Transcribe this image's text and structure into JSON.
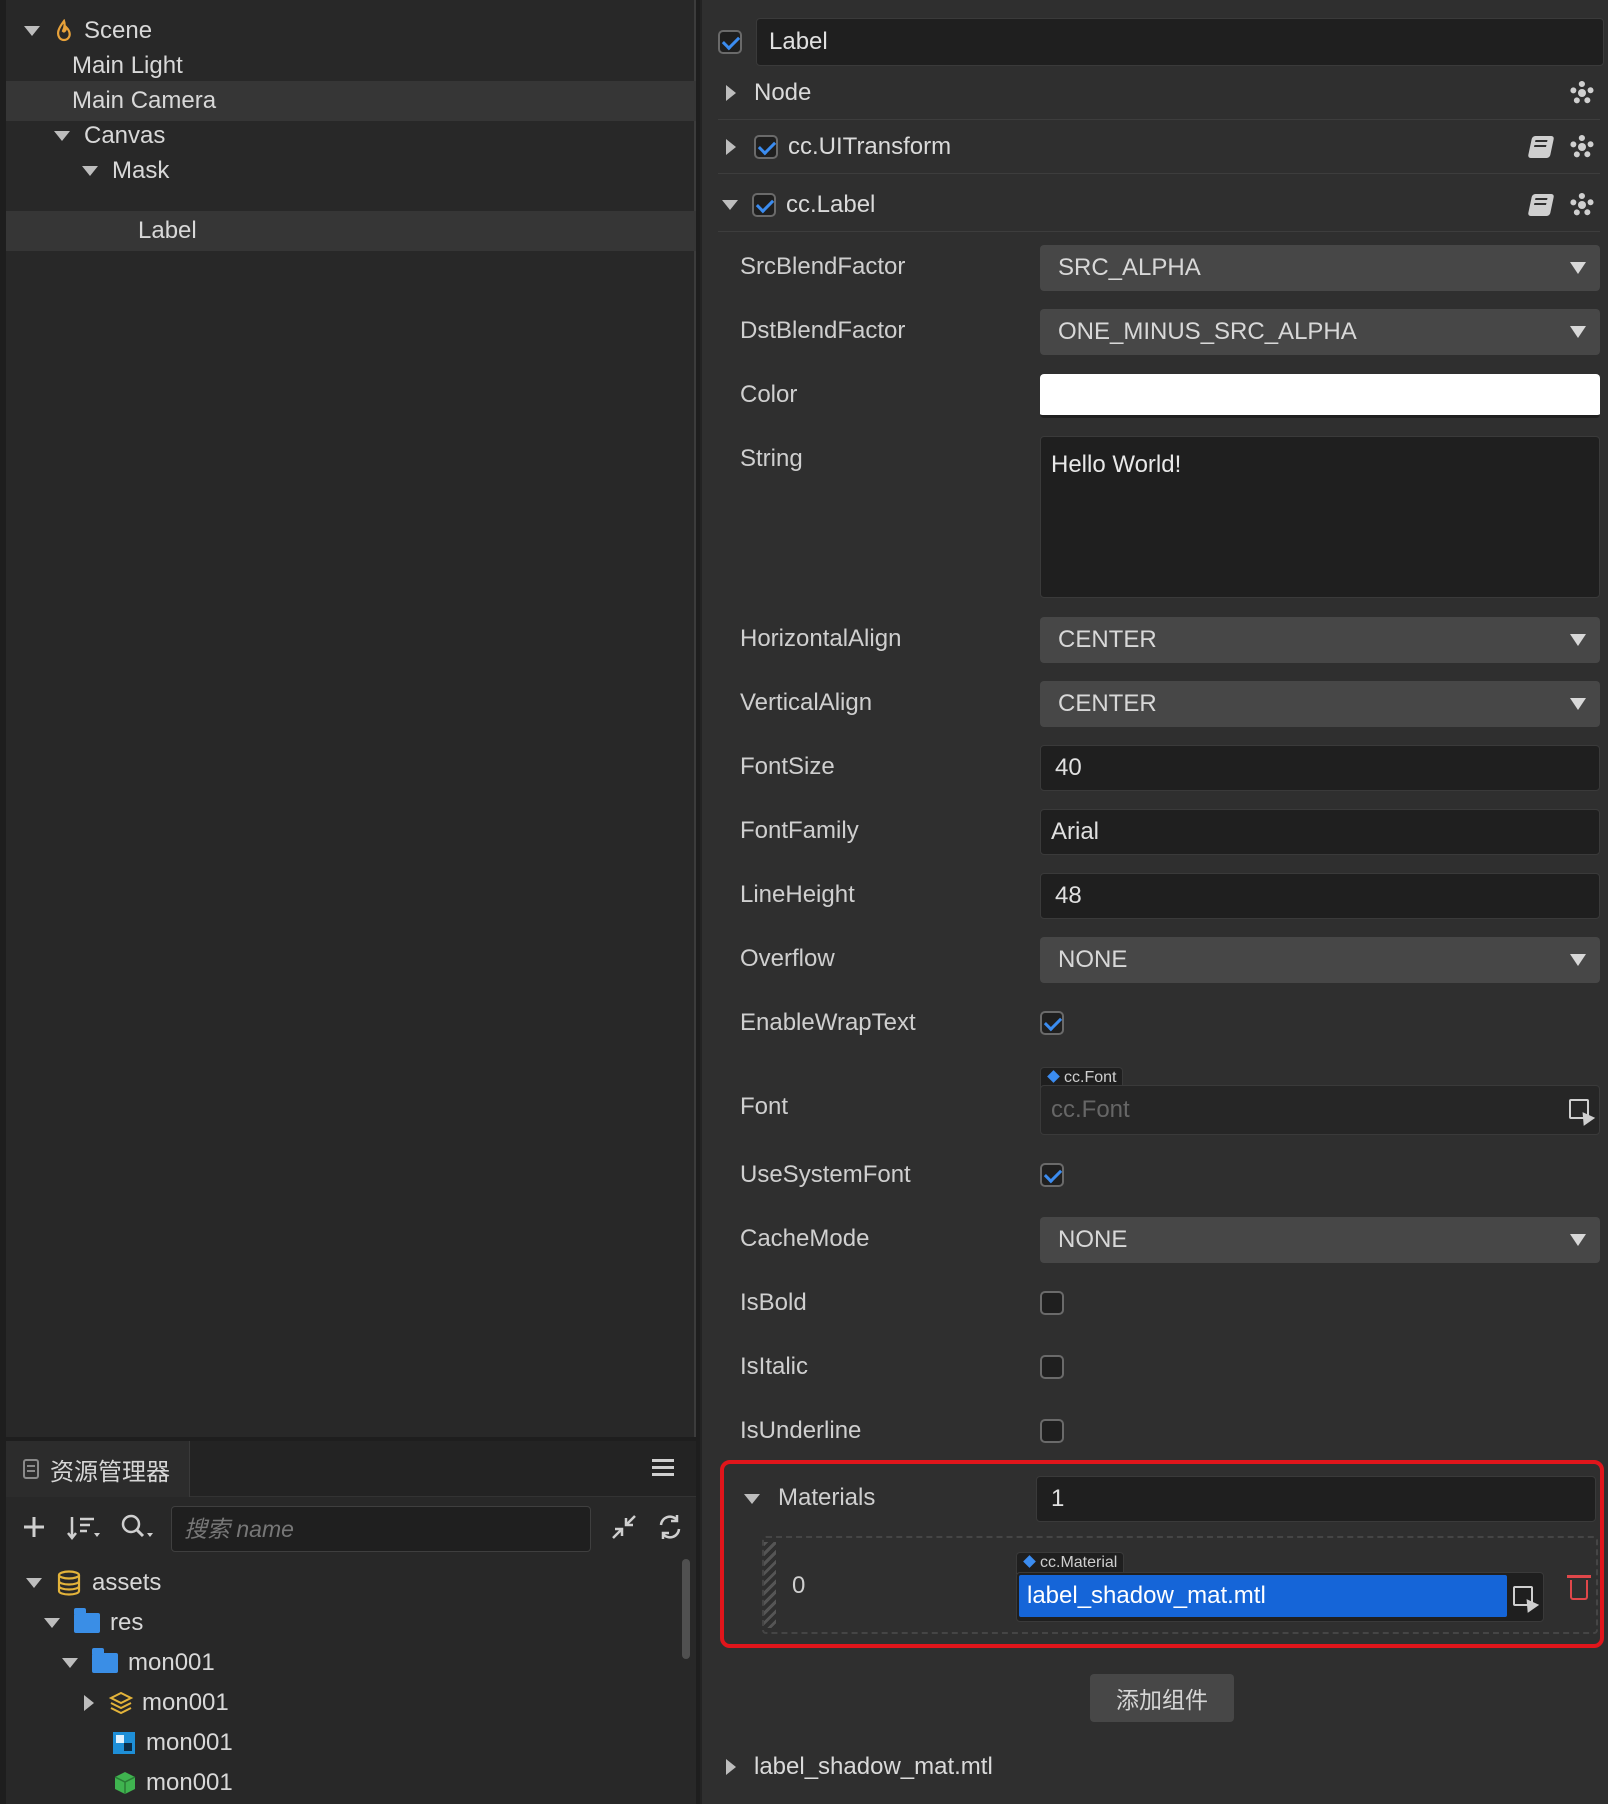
{
  "hierarchy": {
    "items": [
      {
        "label": "Scene"
      },
      {
        "label": "Main Light"
      },
      {
        "label": "Main Camera"
      },
      {
        "label": "Canvas"
      },
      {
        "label": "Mask"
      },
      {
        "label": "Label"
      }
    ]
  },
  "assets": {
    "tab_label": "资源管理器",
    "search_placeholder": "搜索 name",
    "tree": [
      {
        "label": "assets"
      },
      {
        "label": "res"
      },
      {
        "label": "mon001"
      },
      {
        "label": "mon001"
      },
      {
        "label": "mon001"
      },
      {
        "label": "mon001"
      }
    ]
  },
  "inspector": {
    "node_enabled": true,
    "node_name": "Label",
    "node_section": "Node",
    "uitransform": "cc.UITransform",
    "label_component": "cc.Label",
    "props": {
      "src_blend_label": "SrcBlendFactor",
      "src_blend_value": "SRC_ALPHA",
      "dst_blend_label": "DstBlendFactor",
      "dst_blend_value": "ONE_MINUS_SRC_ALPHA",
      "color_label": "Color",
      "color_value": "#ffffff",
      "string_label": "String",
      "string_value": "Hello World!",
      "halign_label": "HorizontalAlign",
      "halign_value": "CENTER",
      "valign_label": "VerticalAlign",
      "valign_value": "CENTER",
      "fontsize_label": "FontSize",
      "fontsize_value": "40",
      "fontfamily_label": "FontFamily",
      "fontfamily_value": "Arial",
      "lineheight_label": "LineHeight",
      "lineheight_value": "48",
      "overflow_label": "Overflow",
      "overflow_value": "NONE",
      "wrap_label": "EnableWrapText",
      "wrap_value": true,
      "font_label": "Font",
      "font_type": "cc.Font",
      "font_value": "cc.Font",
      "sysfont_label": "UseSystemFont",
      "sysfont_value": true,
      "cachemode_label": "CacheMode",
      "cachemode_value": "NONE",
      "bold_label": "IsBold",
      "bold_value": false,
      "italic_label": "IsItalic",
      "italic_value": false,
      "underline_label": "IsUnderline",
      "underline_value": false
    },
    "materials": {
      "label": "Materials",
      "count": "1",
      "index": "0",
      "type": "cc.Material",
      "value": "label_shadow_mat.mtl"
    },
    "add_component": "添加组件",
    "material_section": "label_shadow_mat.mtl"
  },
  "colors": {
    "accent": "#3b8cf0",
    "highlight": "#e0151b",
    "selection": "#1565d8"
  }
}
